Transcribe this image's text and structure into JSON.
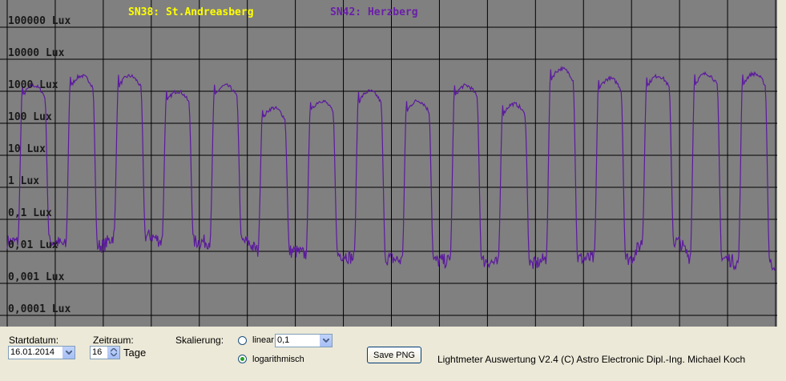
{
  "plot": {
    "y_axis_labels": [
      "100000 Lux",
      "10000 Lux",
      "1000 Lux",
      "100 Lux",
      "10 Lux",
      "1 Lux",
      "0,1 Lux",
      "0,01 Lux",
      "0,001 Lux",
      "0,0001 Lux"
    ],
    "legend": [
      {
        "label": "SN38: St.Andreasberg",
        "color": "#ffff00"
      },
      {
        "label": "SN42: Herzberg",
        "color": "#6a1fa8"
      }
    ],
    "background_color": "#808080",
    "grid_color": "#000000",
    "series_color": "#5c1a9e"
  },
  "chart_data": {
    "type": "line",
    "y_scale": "log",
    "ylim": [
      0.0001,
      100000
    ],
    "x_divisions": 16,
    "y_tick_values": [
      100000,
      10000,
      1000,
      100,
      10,
      1,
      0.1,
      0.01,
      0.001,
      0.0001
    ],
    "series": [
      {
        "name": "SN42: Herzberg",
        "color": "#5c1a9e",
        "day_peaks_lux": [
          1500,
          3000,
          3000,
          1000,
          1500,
          300,
          500,
          1000,
          500,
          1500,
          400,
          5000,
          2500,
          3000,
          3500,
          3500
        ],
        "night_lux": [
          0.02,
          0.015,
          0.03,
          0.02,
          0.02,
          0.01,
          0.008,
          0.006,
          0.005,
          0.005,
          0.004,
          0.006,
          0.006,
          0.02,
          0.006,
          0.004
        ]
      }
    ]
  },
  "controls": {
    "startdatum_label": "Startdatum:",
    "startdatum_value": "16.01.2014",
    "zeitraum_label": "Zeitraum:",
    "zeitraum_value": "16",
    "tage_label": "Tage",
    "skalierung_label": "Skalierung:",
    "linear_label": "linear",
    "linear_value": "0,1",
    "log_label": "logarithmisch",
    "scale_selected": "logarithmisch",
    "save_label": "Save PNG",
    "footer": "Lightmeter Auswertung V2.4  (C) Astro Electronic Dipl.-Ing. Michael Koch"
  }
}
